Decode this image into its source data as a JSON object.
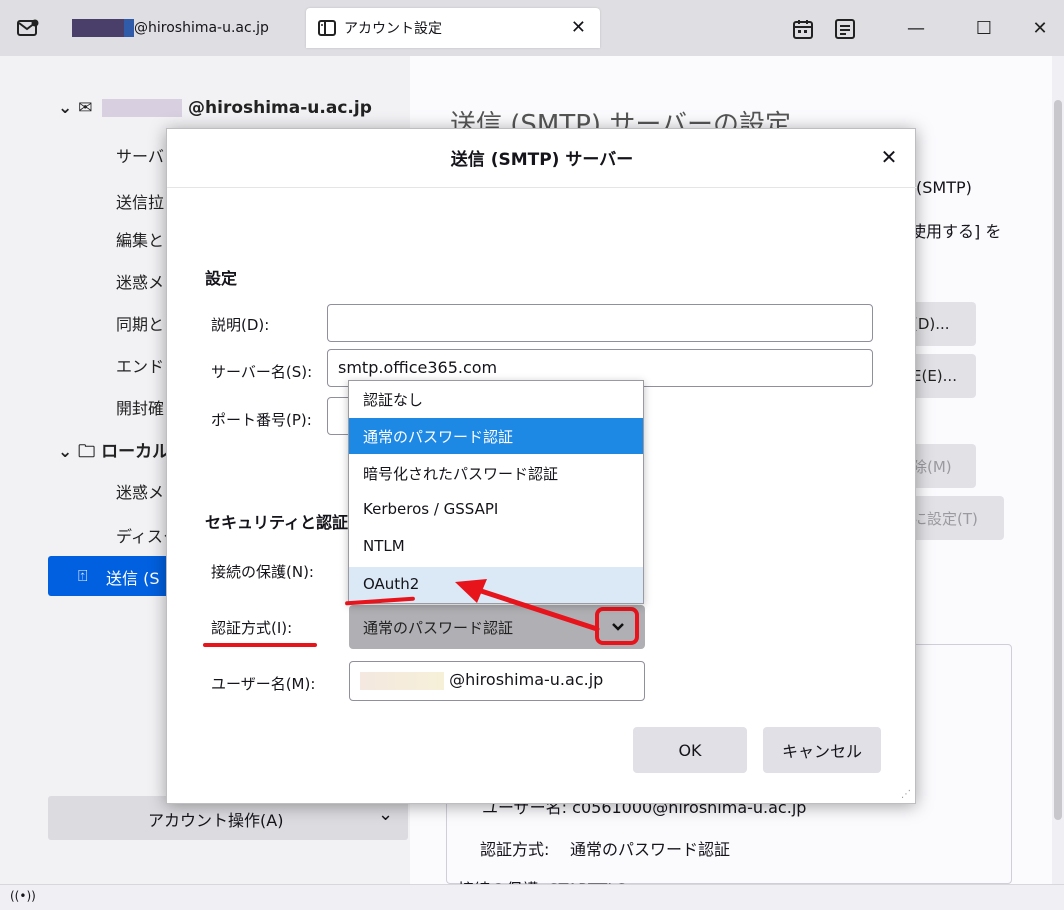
{
  "tabs": {
    "mail_tab": "@hiroshima-u.ac.jp",
    "account_tab": "アカウント設定"
  },
  "window_controls": {
    "minimize": "—",
    "maximize": "☐",
    "close": "✕"
  },
  "sidebar": {
    "account_email": "@hiroshima-u.ac.jp",
    "items": [
      "サーバ",
      "送信拉",
      "編集と",
      "迷惑メ",
      "同期と",
      "エンド",
      "開封確"
    ],
    "local_folders": "ローカル",
    "local_items": [
      "迷惑メ",
      "ディスク"
    ],
    "selected_item": "送信 (S",
    "account_ops": "アカウント操作(A)"
  },
  "content": {
    "heading": "送信 (SMTP) サーバーの設定",
    "line1": "(SMTP)",
    "line2": "使用する] を",
    "btn_add": "(D)...",
    "btn_edit": "E(E)...",
    "btn_remove": "除(M)",
    "btn_default": "に設定(T)",
    "username_line": "ユーザー名: c0561000@hiroshima-u.ac.jp",
    "auth_label": "認証方式:",
    "auth_value": "通常のパスワード認証",
    "conn_line": "接続の保護: STARTTLS"
  },
  "dialog": {
    "title": "送信 (SMTP) サーバー",
    "close": "✕",
    "settings_heading": "設定",
    "description_label": "説明(D):",
    "description_value": "",
    "server_label": "サーバー名(S):",
    "server_value": "smtp.office365.com",
    "port_label": "ポート番号(P):",
    "security_heading": "セキュリティと認証",
    "conn_label": "接続の保護(N):",
    "auth_label": "認証方式(I):",
    "auth_value": "通常のパスワード認証",
    "username_label": "ユーザー名(M):",
    "username_value": "@hiroshima-u.ac.jp",
    "ok": "OK",
    "cancel": "キャンセル"
  },
  "dropdown": {
    "options": [
      "認証なし",
      "通常のパスワード認証",
      "暗号化されたパスワード認証",
      "Kerberos / GSSAPI",
      "NTLM",
      "OAuth2"
    ],
    "selected_index": 1,
    "hover_index": 5
  },
  "colors": {
    "accent": "#0060df",
    "selected_option": "#1e88e5",
    "annotation": "#e8141c"
  }
}
